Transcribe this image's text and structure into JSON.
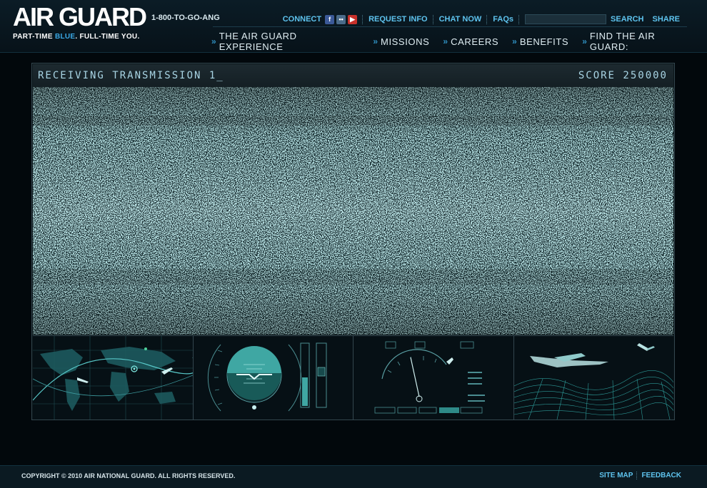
{
  "header": {
    "logo": "AIR GUARD",
    "tagline_a": "PART-TIME ",
    "tagline_b": "BLUE",
    "tagline_c": ". FULL-TIME YOU.",
    "phone": "1-800-TO-GO-ANG",
    "utility": {
      "connect": "CONNECT",
      "request_info": "REQUEST INFO",
      "chat_now": "CHAT NOW",
      "faqs": "FAQs",
      "search_value": "",
      "search": "SEARCH",
      "share": "SHARE"
    },
    "nav": [
      {
        "label": "THE AIR GUARD EXPERIENCE"
      },
      {
        "label": "MISSIONS"
      },
      {
        "label": "CAREERS"
      },
      {
        "label": "BENEFITS"
      },
      {
        "label": "FIND THE AIR GUARD:"
      }
    ]
  },
  "panel": {
    "status": "RECEIVING TRANSMISSION 1_",
    "score": "SCORE 250000",
    "thumbnails": [
      {
        "icon": "world-map-icon"
      },
      {
        "icon": "attitude-indicator-icon"
      },
      {
        "icon": "flight-instrument-icon"
      },
      {
        "icon": "terrain-drone-icon"
      }
    ]
  },
  "footer": {
    "copyright": "COPYRIGHT © 2010 AIR NATIONAL GUARD. ALL RIGHTS RESERVED.",
    "site_map": "SITE MAP",
    "feedback": "FEEDBACK"
  },
  "colors": {
    "accent": "#5ec3ee",
    "noise": "#8fe6ea",
    "background": "#02080c"
  }
}
